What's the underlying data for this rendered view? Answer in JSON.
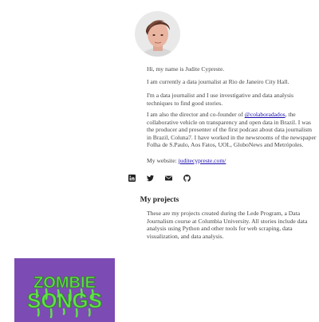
{
  "intro": {
    "greeting": "Hi, my name is Judite Cypreste.",
    "current_role": "I am currently a data journalist at Rio de Janeiro City Hall.",
    "approach": "I'm a data journalist and I use investigative and data analysis techniques to find good stories.",
    "bio_before_link": "I am also the director and co-founder of ",
    "bio_link": "@colaboradados",
    "bio_after_link": ", the collaborative vehicle on transparency and open data in Brazil. I was the producer and presenter of the first podcast about data journalism in Brazil, Coluna7. I have worked in the newsrooms of the newspaper Folha de S.Paulo, Aos Fatos, UOL, GloboNews and Metrópoles.",
    "website_label": "My website: ",
    "website_link": "juditecypreste.com/"
  },
  "socials": [
    {
      "name": "linkedin-icon"
    },
    {
      "name": "twitter-icon"
    },
    {
      "name": "email-icon"
    },
    {
      "name": "github-icon"
    }
  ],
  "projects": {
    "title": "My projects",
    "description": "These are my projects created during the Lede Program, a Data Journalism course at Columbia University. All stories include data analysis using Python and other tools for web scraping, data visualization, and data analysis.",
    "items": [
      {
        "line1": "ZOMBIE",
        "line2": "SONGS",
        "bg_color": "#7d4bb4",
        "text_color": "#5fe04a"
      }
    ]
  },
  "colors": {
    "link": "#1a0dab",
    "text": "#444444",
    "heading": "#222222"
  }
}
